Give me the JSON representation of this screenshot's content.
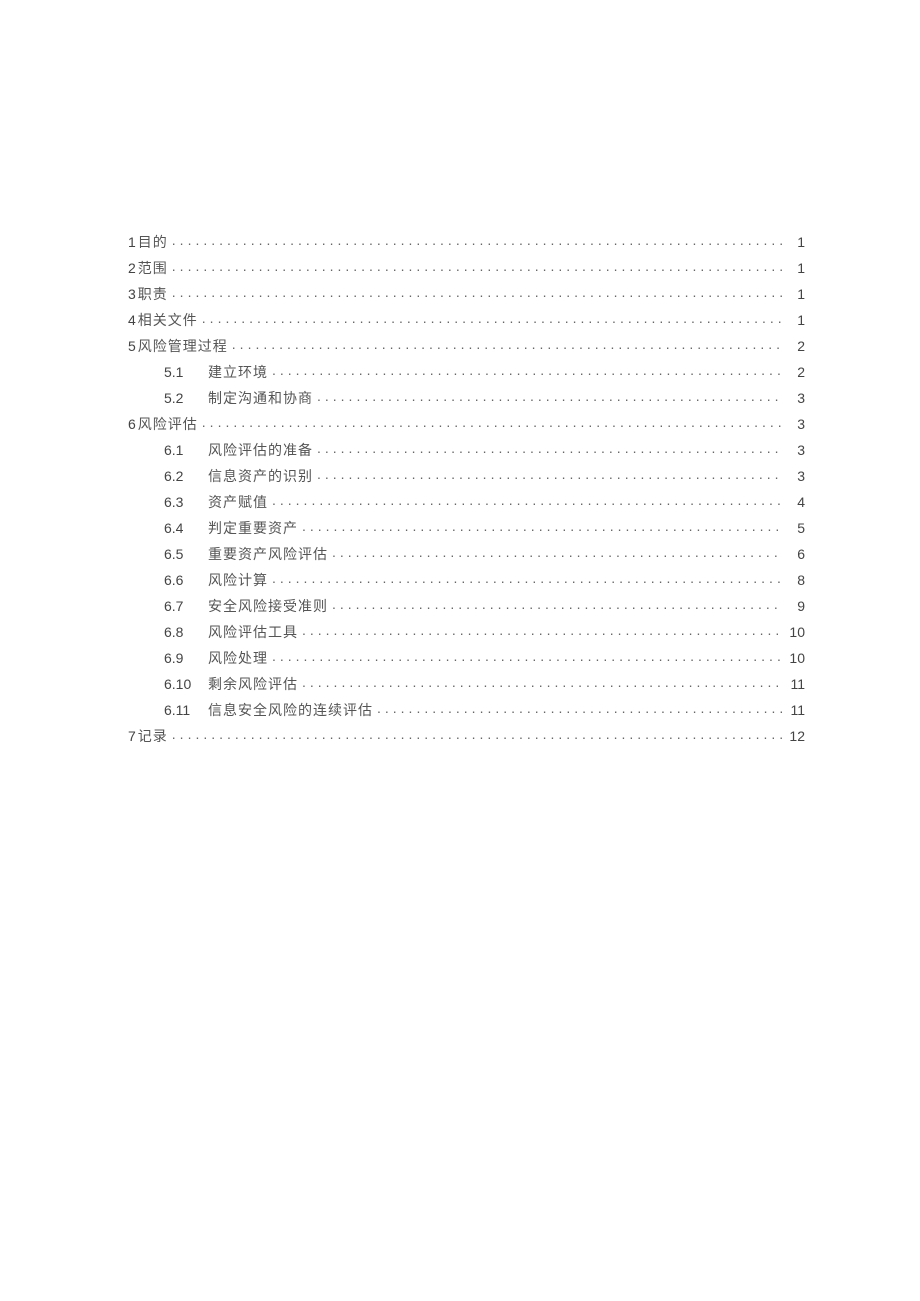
{
  "toc": [
    {
      "level": 1,
      "num": "1",
      "title": "目的",
      "page": "1"
    },
    {
      "level": 1,
      "num": "2",
      "title": "范围",
      "page": "1"
    },
    {
      "level": 1,
      "num": "3",
      "title": "职责",
      "page": "1"
    },
    {
      "level": 1,
      "num": "4",
      "title": "相关文件",
      "page": "1"
    },
    {
      "level": 1,
      "num": "5",
      "title": "风险管理过程",
      "page": "2"
    },
    {
      "level": 2,
      "num": "5.1",
      "title": "建立环境",
      "page": "2"
    },
    {
      "level": 2,
      "num": "5.2",
      "title": "制定沟通和协商",
      "page": "3"
    },
    {
      "level": 1,
      "num": "6",
      "title": "风险评估",
      "page": "3"
    },
    {
      "level": 2,
      "num": "6.1",
      "title": "风险评估的准备",
      "page": "3"
    },
    {
      "level": 2,
      "num": "6.2",
      "title": "信息资产的识别",
      "page": "3"
    },
    {
      "level": 2,
      "num": "6.3",
      "title": "资产赋值",
      "page": "4"
    },
    {
      "level": 2,
      "num": "6.4",
      "title": "判定重要资产",
      "page": "5"
    },
    {
      "level": 2,
      "num": "6.5",
      "title": "重要资产风险评估",
      "page": "6"
    },
    {
      "level": 2,
      "num": "6.6",
      "title": "风险计算",
      "page": "8"
    },
    {
      "level": 2,
      "num": "6.7",
      "title": "安全风险接受准则",
      "page": "9"
    },
    {
      "level": 2,
      "num": "6.8",
      "title": "风险评估工具",
      "page": "10"
    },
    {
      "level": 2,
      "num": "6.9",
      "title": "风险处理",
      "page": "10"
    },
    {
      "level": 2,
      "num": "6.10",
      "title": "剩余风险评估",
      "page": "11"
    },
    {
      "level": 2,
      "num": "6.11",
      "title": "信息安全风险的连续评估",
      "page": "11"
    },
    {
      "level": 1,
      "num": "7",
      "title": "记录",
      "page": "12"
    }
  ]
}
